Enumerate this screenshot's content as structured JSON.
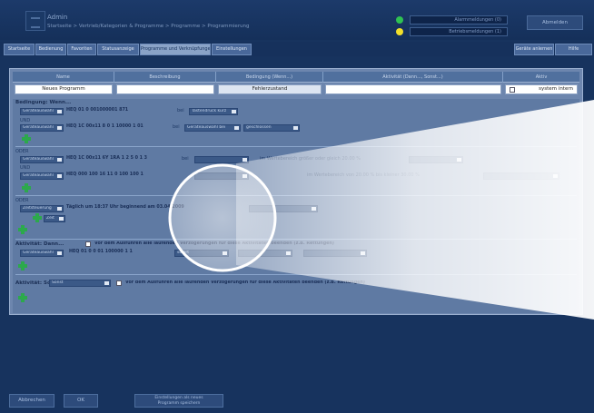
{
  "header": {
    "title": "Admin",
    "breadcrumb": "Startseite > Vertrieb/Kategorien & Programme > Programme > Programmierung",
    "status": [
      {
        "label": "Alarmmeldungen (0)",
        "color": "#2fc252"
      },
      {
        "label": "Betriebsmeldungen (1)",
        "color": "#f2df2a"
      }
    ],
    "logout_label": "Abmelden"
  },
  "tabs": {
    "left": [
      "Startseite",
      "Bedienung",
      "Favoriten",
      "Statusanzeige",
      "Programme und Verknüpfungen",
      "Einstellungen"
    ],
    "right": [
      "Geräte anlernen",
      "Hilfe"
    ]
  },
  "table": {
    "headers": [
      "Name",
      "Beschreibung",
      "Bedingung (Wenn...)",
      "Aktivität (Dann..., Sonst...)",
      "Aktiv"
    ],
    "row": {
      "name": "Neues Programm",
      "description": "",
      "condition": "Fehlerzustand",
      "activity": "",
      "active_label": "system intern"
    }
  },
  "conditions": {
    "heading": "Bedingung: Wenn...",
    "and_label": "UND",
    "or_label": "ODER",
    "block1": {
      "line1_select": "Geräteauswahl",
      "line1_device": "HEQ 01 0 001000001 871",
      "line1_mid": "bei",
      "line1_select2": "Tastendruck kurz",
      "line2_select": "Geräteauswahl",
      "line2_device": "HEQ 1C 00x11 8 0 1 10000 1 01",
      "line2_mid": "bei",
      "line2_select2": "Geräteauswahl bei",
      "line2_select3": "geschlossen"
    },
    "block2": {
      "line1_select": "Geräteauswahl",
      "line1_device": "HEQ 1C 00x11 6Y 1RA 1 2 5 0 1 3",
      "line1_mid": "bei",
      "line1_text": "im Wertebereich größer oder gleich 20.00 %",
      "line2_select": "Geräteauswahl",
      "line2_device": "HEQ 000 100 16 11 0 100 100 1",
      "line2_text": "im Wertebereich von 20.00 % bis kleiner 30.00 %"
    },
    "block3": {
      "select": "Zeitsteuerung",
      "text": "Täglich um 18:37 Uhr beginnend am 03.04.2009",
      "small_select": "Zeit"
    }
  },
  "activity1": {
    "label": "Aktivität: Dann...",
    "checkbox_text": "Vor dem Ausführen alle laufenden Verzögerungen für diese Aktivitäten beenden (z.B. Rettungen)",
    "select": "Geräteauswahl",
    "device": "HEQ 01 0 0 01 100000 1 1",
    "action_select": "sofort"
  },
  "activity2": {
    "label": "Aktivität: Sonst",
    "select": "Sonst",
    "checkbox_text": "Vor dem Ausführen alle laufenden Verzögerungen für diese Aktivitäten beenden (z.B. Rettungen)"
  },
  "footer": {
    "cancel_label": "Abbrechen",
    "ok_label": "OK",
    "save_template_line1": "Einstellungen als neues",
    "save_template_line2": "Programm speichern"
  },
  "colors": {
    "background": "#17335e",
    "panel": "#6d86ae",
    "accent_green": "#2ca94c"
  }
}
